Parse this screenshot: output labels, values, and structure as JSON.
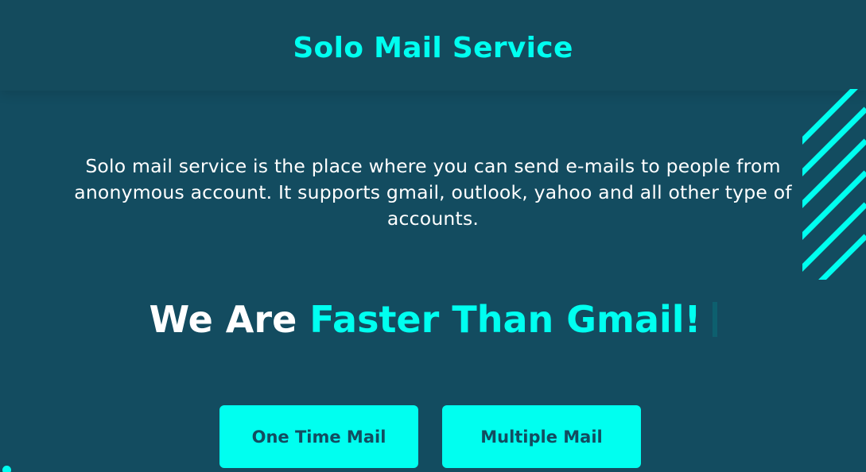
{
  "header": {
    "title": "Solo Mail Service"
  },
  "hero": {
    "description": "Solo mail service is the place where you can send e-mails to people from anonymous account. It supports gmail, outlook, yahoo and all other type of accounts.",
    "tagline_lead": "We Are",
    "tagline_accent": "Faster Than Gmail!"
  },
  "actions": {
    "one_time_label": "One Time Mail",
    "multiple_label": "Multiple Mail"
  },
  "colors": {
    "background": "#134c60",
    "accent": "#00fff0",
    "text": "#ffffff"
  },
  "decor": {
    "stripes_icon": "diagonal-stripes-decoration"
  }
}
